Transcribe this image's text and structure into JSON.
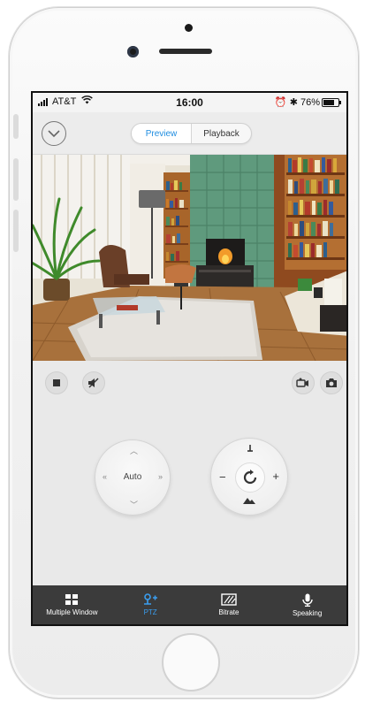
{
  "status_bar": {
    "carrier": "AT&T",
    "time": "16:00",
    "battery_percent": "76%",
    "battery_level": 0.76
  },
  "header": {
    "back_icon": "chevron-down-circle-icon",
    "tabs": [
      {
        "label": "Preview",
        "active": true
      },
      {
        "label": "Playback",
        "active": false
      }
    ]
  },
  "video": {
    "scene": "living-room-camera-feed"
  },
  "toolbar": {
    "left": [
      "stop-icon",
      "mute-icon"
    ],
    "right": [
      "record-video-icon",
      "snapshot-icon"
    ]
  },
  "ptz": {
    "direction_pad_label": "Auto",
    "zoom_minus": "−",
    "zoom_plus": "+"
  },
  "tab_bar": {
    "items": [
      {
        "label": "Multiple Window",
        "icon": "grid-icon",
        "active": false
      },
      {
        "label": "PTZ",
        "icon": "ptz-icon",
        "active": true
      },
      {
        "label": "Bitrate",
        "icon": "bitrate-icon",
        "active": false
      },
      {
        "label": "Speaking",
        "icon": "microphone-icon",
        "active": false
      }
    ]
  },
  "colors": {
    "accent": "#1f8de0",
    "tab_bar_bg": "#3b3b3b",
    "tab_active": "#3a9ef0"
  }
}
